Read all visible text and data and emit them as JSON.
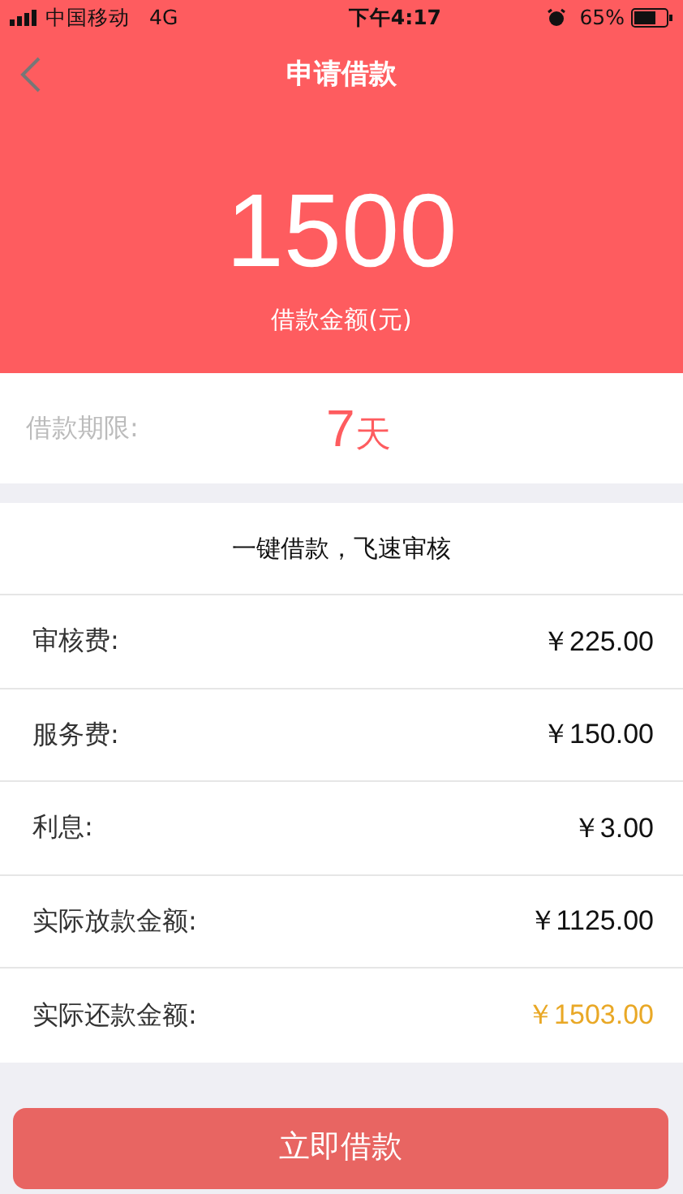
{
  "status_bar": {
    "carrier": "中国移动",
    "network": "4G",
    "time": "下午4:17",
    "battery": "65%"
  },
  "header": {
    "title": "申请借款",
    "amount": "1500",
    "amount_label": "借款金额(元)"
  },
  "period": {
    "label": "借款期限:",
    "number": "7",
    "unit": "天"
  },
  "fees": {
    "heading": "一键借款，飞速审核",
    "rows": [
      {
        "label": "审核费:",
        "value": "￥225.00",
        "highlight": false
      },
      {
        "label": "服务费:",
        "value": "￥150.00",
        "highlight": false
      },
      {
        "label": "利息:",
        "value": "￥3.00",
        "highlight": false
      },
      {
        "label": "实际放款金额:",
        "value": "￥1125.00",
        "highlight": false
      },
      {
        "label": "实际还款金额:",
        "value": "￥1503.00",
        "highlight": true
      }
    ]
  },
  "submit_button": "立即借款"
}
